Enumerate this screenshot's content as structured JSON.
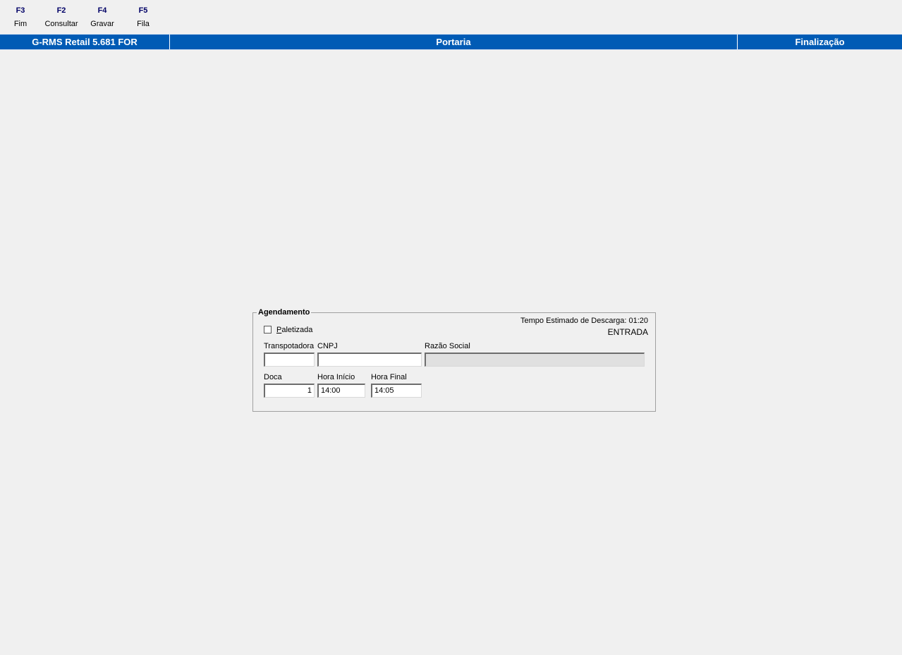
{
  "fkeys": [
    {
      "key": "F3",
      "label": "Fim"
    },
    {
      "key": "F2",
      "label": "Consultar"
    },
    {
      "key": "F4",
      "label": "Gravar"
    },
    {
      "key": "F5",
      "label": "Fila"
    }
  ],
  "titlebar": {
    "app": "G-RMS Retail 5.681 FOR",
    "module": "Portaria",
    "mode": "Finalização",
    "color": "#005bb5"
  },
  "agendamento": {
    "title": "Agendamento",
    "tempo_estimado": "Tempo Estimado de Descarga: 01:20",
    "tipo": "ENTRADA",
    "paletizada_label_first": "P",
    "paletizada_label_rest": "aletizada",
    "paletizada_checked": false,
    "labels": {
      "transportadora": "Transpotadora",
      "cnpj": "CNPJ",
      "razao_social": "Razão Social",
      "doca": "Doca",
      "hora_inicio": "Hora Início",
      "hora_final": "Hora Final"
    },
    "values": {
      "transportadora": "",
      "cnpj": "",
      "razao_social": "",
      "doca": "1",
      "hora_inicio": "14:00",
      "hora_final": "14:05"
    }
  }
}
